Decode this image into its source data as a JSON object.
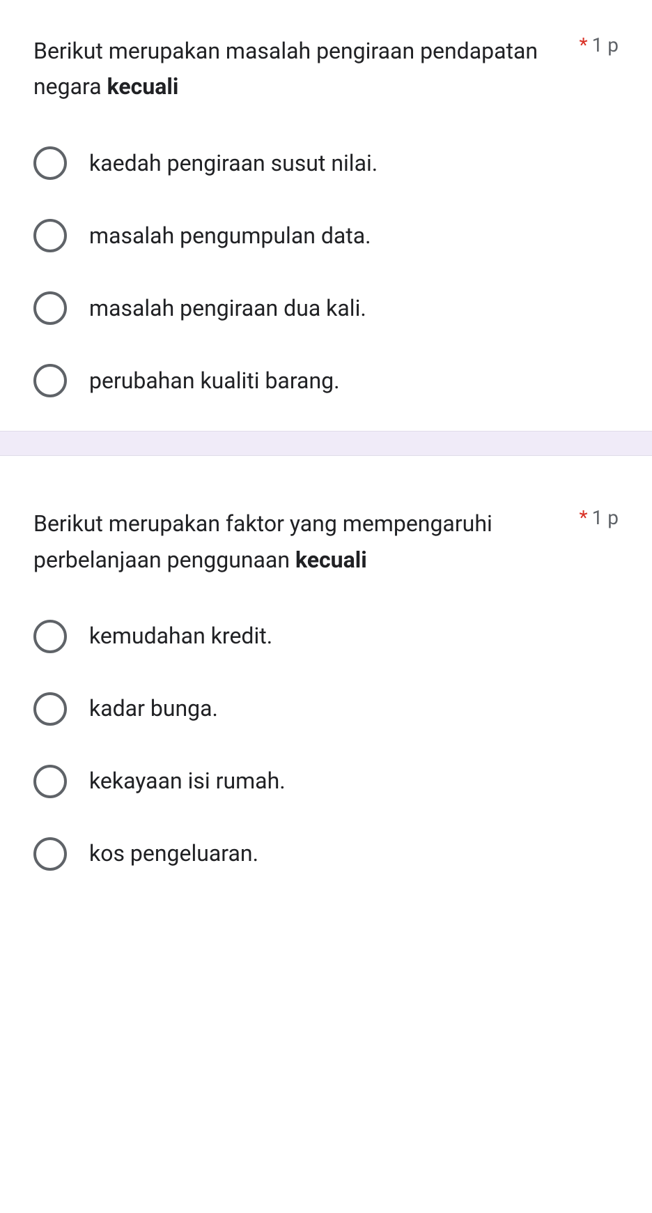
{
  "questions": [
    {
      "text_part1": "Berikut merupakan masalah pengiraan pendapatan negara ",
      "text_bold": "kecuali",
      "required": "*",
      "points": "1 p",
      "options": [
        "kaedah pengiraan susut nilai.",
        "masalah pengumpulan data.",
        "masalah pengiraan dua kali.",
        "perubahan kualiti barang."
      ]
    },
    {
      "text_part1": "Berikut merupakan faktor yang mempengaruhi perbelanjaan penggunaan ",
      "text_bold": "kecuali",
      "required": "*",
      "points": "1 p",
      "options": [
        "kemudahan kredit.",
        "kadar bunga.",
        "kekayaan isi rumah.",
        "kos pengeluaran."
      ]
    }
  ]
}
